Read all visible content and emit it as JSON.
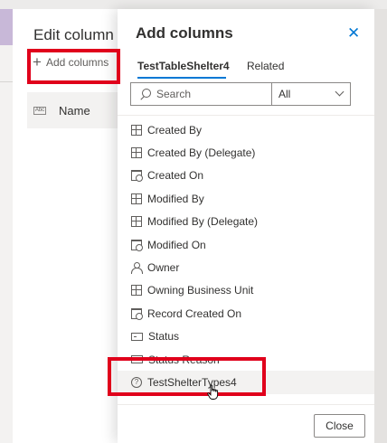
{
  "edit_panel": {
    "title": "Edit column",
    "add_columns_label": "Add columns",
    "column_name": "Name"
  },
  "add_panel": {
    "title": "Add columns",
    "tabs": [
      {
        "label": "TestTableShelter4"
      },
      {
        "label": "Related"
      }
    ],
    "search": {
      "placeholder": "Search"
    },
    "filter": {
      "selected": "All"
    },
    "columns": [
      {
        "label": "Created By",
        "icon": "lookup-icon"
      },
      {
        "label": "Created By (Delegate)",
        "icon": "lookup-icon"
      },
      {
        "label": "Created On",
        "icon": "calendar-icon"
      },
      {
        "label": "Modified By",
        "icon": "lookup-icon"
      },
      {
        "label": "Modified By (Delegate)",
        "icon": "lookup-icon"
      },
      {
        "label": "Modified On",
        "icon": "calendar-icon"
      },
      {
        "label": "Owner",
        "icon": "person-icon"
      },
      {
        "label": "Owning Business Unit",
        "icon": "lookup-icon"
      },
      {
        "label": "Record Created On",
        "icon": "calendar-icon"
      },
      {
        "label": "Status",
        "icon": "status-icon"
      },
      {
        "label": "Status Reason",
        "icon": "status-icon"
      },
      {
        "label": "TestShelterTypes4",
        "icon": "choice-icon"
      }
    ],
    "close_label": "Close"
  },
  "colors": {
    "accent": "#0078d4",
    "annotation_red": "#e0001b"
  }
}
